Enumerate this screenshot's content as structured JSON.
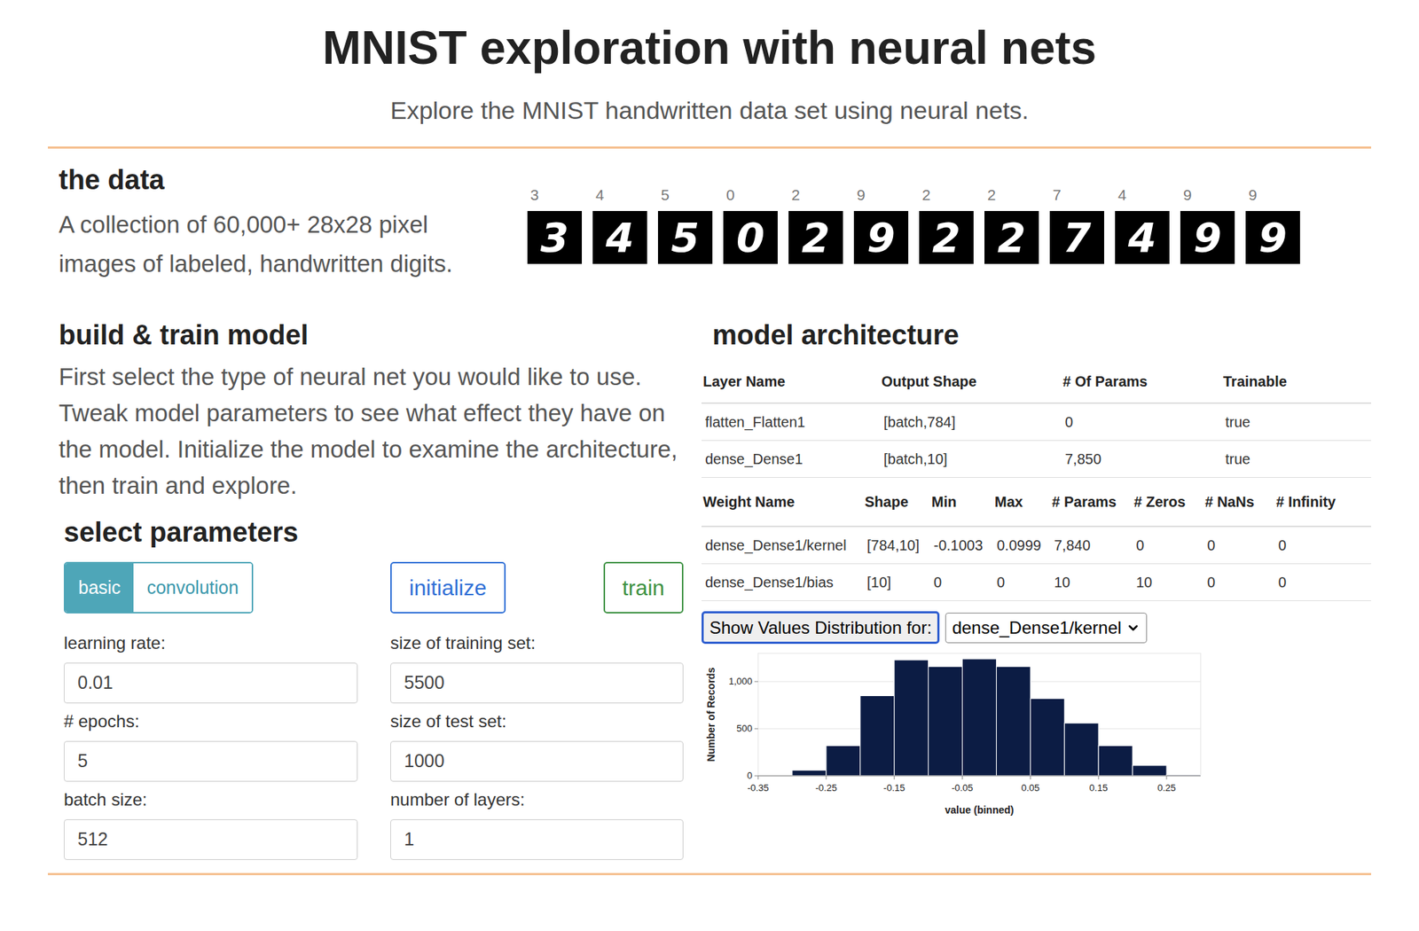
{
  "header": {
    "title": "MNIST exploration with neural nets",
    "subtitle": "Explore the MNIST handwritten data set using neural nets."
  },
  "data_section": {
    "heading": "the data",
    "description": "A collection of 60,000+ 28x28 pixel images of labeled, handwritten digits.",
    "samples": [
      {
        "label": "3"
      },
      {
        "label": "4"
      },
      {
        "label": "5"
      },
      {
        "label": "0"
      },
      {
        "label": "2"
      },
      {
        "label": "9"
      },
      {
        "label": "2"
      },
      {
        "label": "2"
      },
      {
        "label": "7"
      },
      {
        "label": "4"
      },
      {
        "label": "9"
      },
      {
        "label": "9"
      }
    ]
  },
  "build_section": {
    "heading": "build & train model",
    "description": "First select the type of neural net you would like to use. Tweak model parameters to see what effect they have on the model. Initialize the model to examine the architecture, then train and explore."
  },
  "parameters": {
    "heading": "select parameters",
    "model_types": [
      {
        "label": "basic",
        "selected": true
      },
      {
        "label": "convolution",
        "selected": false
      }
    ],
    "buttons": [
      {
        "label": "initialize",
        "color": "#2f6fd6"
      },
      {
        "label": "train",
        "color": "#3d9142"
      }
    ],
    "fields": [
      {
        "label": "learning rate:",
        "value": "0.01"
      },
      {
        "label": "# epochs:",
        "value": "5"
      },
      {
        "label": "batch size:",
        "value": "512"
      },
      {
        "label": "size of training set:",
        "value": "5500"
      },
      {
        "label": "size of test set:",
        "value": "1000"
      },
      {
        "label": "number of layers:",
        "value": "1"
      }
    ]
  },
  "architecture": {
    "heading": "model architecture",
    "layers": {
      "columns": [
        "Layer Name",
        "Output Shape",
        "# Of Params",
        "Trainable"
      ],
      "rows": [
        [
          "flatten_Flatten1",
          "[batch,784]",
          "0",
          "true"
        ],
        [
          "dense_Dense1",
          "[batch,10]",
          "7,850",
          "true"
        ]
      ]
    },
    "weights": {
      "columns": [
        "Weight Name",
        "Shape",
        "Min",
        "Max",
        "# Params",
        "# Zeros",
        "# NaNs",
        "# Infinity"
      ],
      "rows": [
        [
          "dense_Dense1/kernel",
          "[784,10]",
          "-0.1003",
          "0.0999",
          "7,840",
          "0",
          "0",
          "0"
        ],
        [
          "dense_Dense1/bias",
          "[10]",
          "0",
          "0",
          "10",
          "10",
          "0",
          "0"
        ]
      ]
    },
    "distribution": {
      "button": "Show Values Distribution for:",
      "selected_weight": "dense_Dense1/kernel",
      "chart": {
        "y_label": "Number of Records",
        "x_label": "value (binned)",
        "y_ticks": [
          "1,000",
          "500",
          "0"
        ],
        "x_ticks": [
          "-0.35",
          "-0.25",
          "-0.15",
          "-0.05",
          "0.05",
          "0.15",
          "0.25"
        ],
        "bin_start": -0.35,
        "bin_width": 0.05,
        "values": [
          0,
          60,
          320,
          850,
          1230,
          1160,
          1240,
          1160,
          820,
          560,
          320,
          110,
          10
        ]
      }
    }
  }
}
